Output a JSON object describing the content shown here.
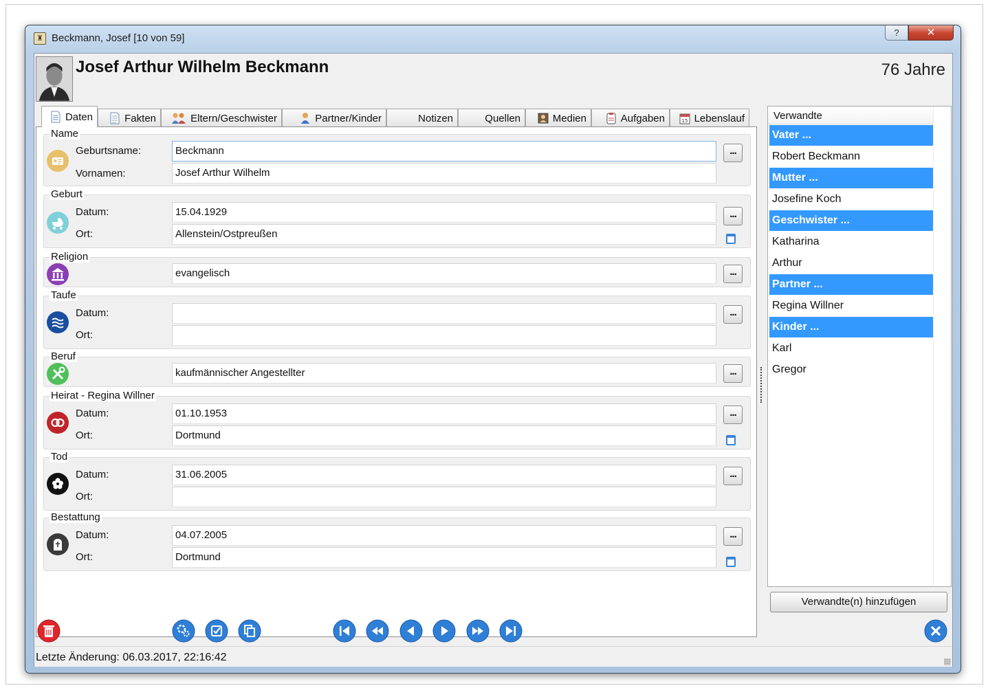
{
  "window": {
    "title": "Beckmann, Josef [10 von 59]",
    "help_label": "?",
    "close_label": "✕"
  },
  "person": {
    "full_name": "Josef Arthur Wilhelm Beckmann",
    "age": "76 Jahre"
  },
  "tabs": [
    {
      "label": "Daten",
      "icon": "document-icon",
      "active": true
    },
    {
      "label": "Fakten",
      "icon": "document-lines-icon"
    },
    {
      "label": "Eltern/Geschwister",
      "icon": "family-icon"
    },
    {
      "label": "Partner/Kinder",
      "icon": "person-icon"
    },
    {
      "label": "Notizen"
    },
    {
      "label": "Quellen"
    },
    {
      "label": "Medien",
      "icon": "image-icon"
    },
    {
      "label": "Aufgaben",
      "icon": "clipboard-icon"
    },
    {
      "label": "Lebenslauf",
      "icon": "calendar-icon"
    }
  ],
  "groups": {
    "name": {
      "title": "Name",
      "birthname_label": "Geburtsname:",
      "birthname": "Beckmann",
      "firstnames_label": "Vornamen:",
      "firstnames": "Josef Arthur Wilhelm"
    },
    "birth": {
      "title": "Geburt",
      "date_label": "Datum:",
      "date": "15.04.1929",
      "place_label": "Ort:",
      "place": "Allenstein/Ostpreußen"
    },
    "religion": {
      "title": "Religion",
      "value": "evangelisch"
    },
    "baptism": {
      "title": "Taufe",
      "date_label": "Datum:",
      "date": "",
      "place_label": "Ort:",
      "place": ""
    },
    "occupation": {
      "title": "Beruf",
      "value": "kaufmännischer Angestellter"
    },
    "marriage": {
      "title": "Heirat - Regina Willner",
      "date_label": "Datum:",
      "date": "01.10.1953",
      "place_label": "Ort:",
      "place": "Dortmund"
    },
    "death": {
      "title": "Tod",
      "date_label": "Datum:",
      "date": "31.06.2005",
      "place_label": "Ort:",
      "place": ""
    },
    "burial": {
      "title": "Bestattung",
      "date_label": "Datum:",
      "date": "04.07.2005",
      "place_label": "Ort:",
      "place": "Dortmund"
    }
  },
  "more_button_label": "...",
  "relatives": {
    "header": "Verwandte",
    "items": [
      {
        "label": "Vater ...",
        "type": "heading"
      },
      {
        "label": "Robert Beckmann",
        "type": "person"
      },
      {
        "label": "Mutter ...",
        "type": "heading"
      },
      {
        "label": "Josefine Koch",
        "type": "person"
      },
      {
        "label": "Geschwister ...",
        "type": "heading"
      },
      {
        "label": "Katharina",
        "type": "person"
      },
      {
        "label": "Arthur",
        "type": "person"
      },
      {
        "label": "Partner ...",
        "type": "heading"
      },
      {
        "label": "Regina Willner",
        "type": "person"
      },
      {
        "label": "Kinder ...",
        "type": "heading"
      },
      {
        "label": "Karl",
        "type": "person"
      },
      {
        "label": "Gregor",
        "type": "person"
      }
    ],
    "add_button": "Verwandte(n) hinzufügen"
  },
  "toolbar_icons": [
    "trash-icon",
    "settings-icon",
    "checklist-icon",
    "copy-icon",
    "first-record-icon",
    "rewind-icon",
    "previous-icon",
    "next-icon",
    "fast-forward-icon",
    "last-record-icon",
    "close-icon"
  ],
  "status": {
    "last_change": "Letzte Änderung: 06.03.2017, 22:16:42"
  },
  "colors": {
    "selection_blue": "#3399ff",
    "nav_blue": "#2f7fd6",
    "delete_red": "#e0262b",
    "name_icon": "#e6c06a",
    "birth_icon": "#7fd0d8",
    "religion_icon": "#8a3fb5",
    "baptism_icon": "#1a4e9e",
    "occupation_icon": "#4fc05a",
    "marriage_icon": "#c0242b",
    "death_icon": "#111111",
    "burial_icon": "#3a3a3a"
  }
}
